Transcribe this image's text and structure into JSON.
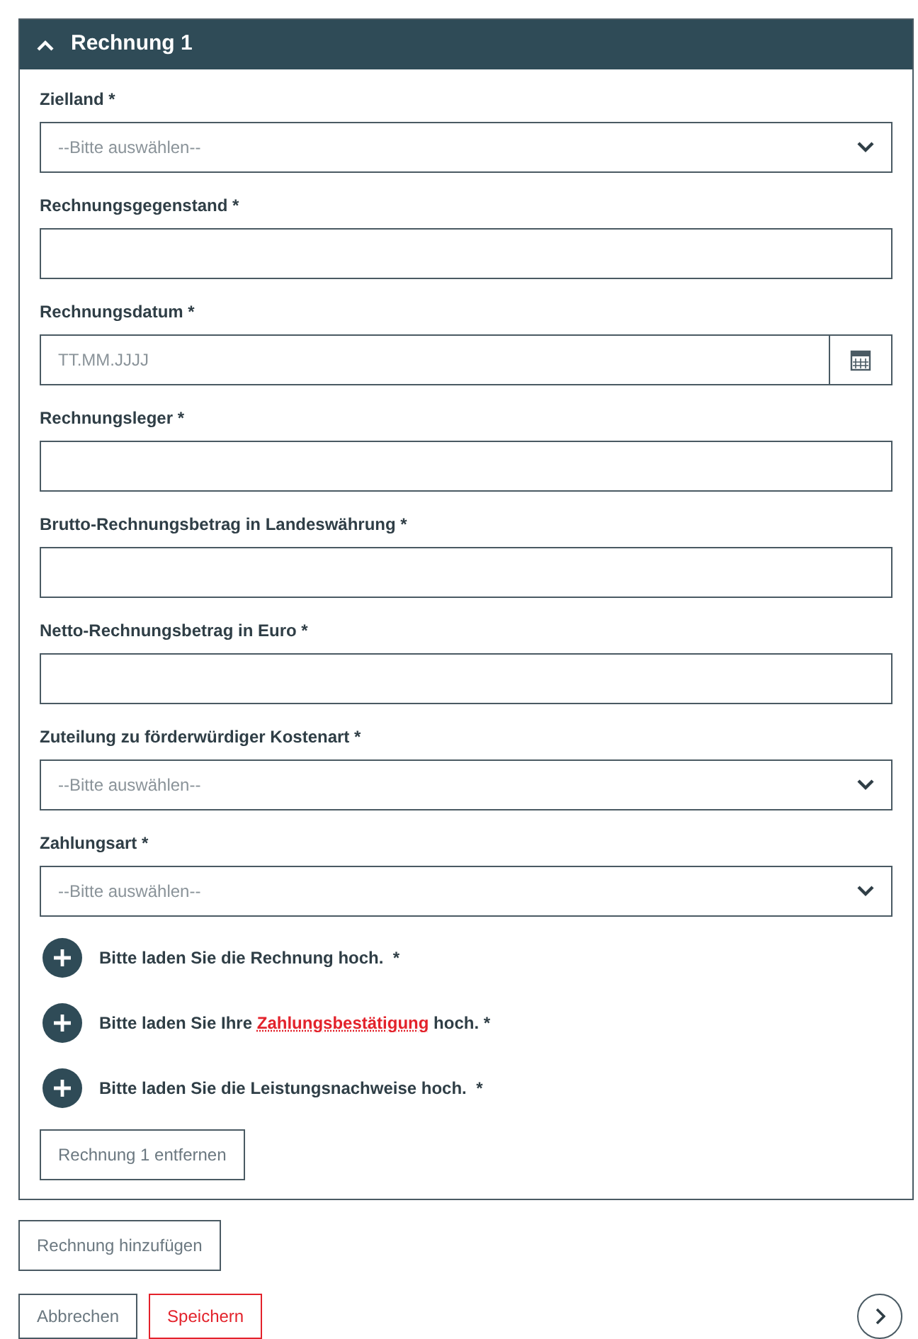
{
  "panel": {
    "title": "Rechnung 1",
    "expanded": true
  },
  "fields": [
    {
      "kind": "select",
      "label": "Zielland *",
      "placeholder": "--Bitte auswählen--"
    },
    {
      "kind": "text",
      "label": "Rechnungsgegenstand *"
    },
    {
      "kind": "date",
      "label": "Rechnungsdatum *",
      "placeholder": "TT.MM.JJJJ"
    },
    {
      "kind": "text",
      "label": "Rechnungsleger *"
    },
    {
      "kind": "text",
      "label": "Brutto-Rechnungsbetrag in Landeswährung *"
    },
    {
      "kind": "text",
      "label": "Netto-Rechnungsbetrag in Euro *"
    },
    {
      "kind": "select",
      "label": "Zuteilung zu förderwürdiger Kostenart *",
      "placeholder": "--Bitte auswählen--"
    },
    {
      "kind": "select",
      "label": "Zahlungsart *",
      "placeholder": "--Bitte auswählen--"
    }
  ],
  "uploads": [
    {
      "parts": [
        {
          "kind": "plain",
          "text": "Bitte laden Sie die Rechnung hoch.  *"
        }
      ]
    },
    {
      "parts": [
        {
          "kind": "plain",
          "text": "Bitte laden Sie Ihre "
        },
        {
          "kind": "link",
          "text": "Zahlungsbestätigung"
        },
        {
          "kind": "plain",
          "text": " hoch. *"
        }
      ]
    },
    {
      "parts": [
        {
          "kind": "plain",
          "text": "Bitte laden Sie die Leistungsnachweise hoch.  *"
        }
      ]
    }
  ],
  "remove_button": "Rechnung 1 entfernen",
  "add_button": "Rechnung hinzufügen",
  "actions": [
    {
      "kind": "secondary",
      "label": "Abbrechen"
    },
    {
      "kind": "primary",
      "label": "Speichern"
    }
  ]
}
